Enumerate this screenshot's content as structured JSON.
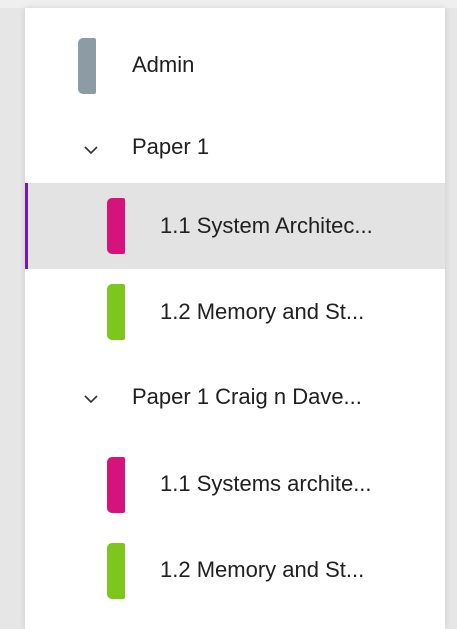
{
  "sections": [
    {
      "label": "Admin",
      "color": "#8d9ba5",
      "type": "section"
    },
    {
      "label": "Paper 1",
      "type": "group"
    },
    {
      "label": "1.1 System Architec...",
      "color": "#d6137a",
      "type": "page",
      "selected": true
    },
    {
      "label": "1.2 Memory and St...",
      "color": "#7dc61e",
      "type": "page"
    },
    {
      "label": "Paper 1 Craig n Dave...",
      "type": "group"
    },
    {
      "label": "1.1 Systems archite...",
      "color": "#d6137a",
      "type": "page"
    },
    {
      "label": "1.2 Memory and St...",
      "color": "#7dc61e",
      "type": "page"
    }
  ],
  "colors": {
    "selected_bg": "#e3e3e3",
    "selected_accent": "#7719aa",
    "pink_tab": "#d6137a",
    "green_tab": "#7dc61e",
    "grey_tab": "#8d9ba5"
  }
}
